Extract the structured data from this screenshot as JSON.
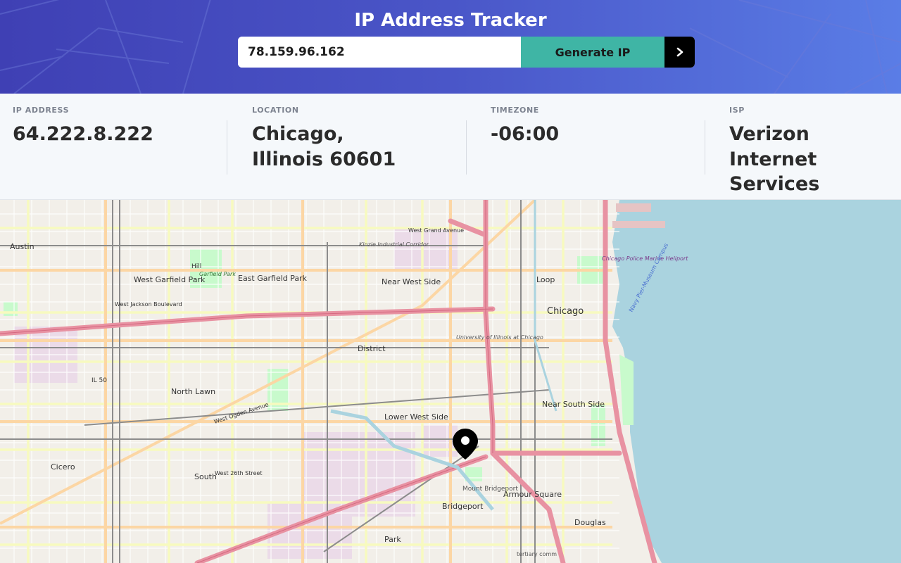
{
  "header": {
    "title": "IP Address Tracker",
    "search_value": "78.159.96.162",
    "generate_label": "Generate IP",
    "go_icon": "chevron-right-icon"
  },
  "info": {
    "ip": {
      "label": "IP ADDRESS",
      "value": "64.222.8.222"
    },
    "location": {
      "label": "LOCATION",
      "value": "Chicago, Illinois 60601"
    },
    "timezone": {
      "label": "TIMEZONE",
      "value": "-06:00"
    },
    "isp": {
      "label": "ISP",
      "value": "Verizon Internet Services"
    }
  },
  "map": {
    "places": {
      "austin": "Austin",
      "west_garfield_park": "West Garfield Park",
      "garfield_park": "Garfield Park",
      "hill": "Hill",
      "east_garfield_park": "East Garfield Park",
      "west_jackson_blvd": "West Jackson Boulevard",
      "kinzie_corridor": "Kinzie Industrial Corridor",
      "west_grand_ave": "West Grand Avenue",
      "near_west_side": "Near West Side",
      "loop": "Loop",
      "chicago": "Chicago",
      "police_heliport": "Chicago Police Marine Heliport",
      "navy_pier": "Navy Pier-Museum Campus",
      "district": "District",
      "uic": "University of Illinois at Chicago",
      "il50": "IL 50",
      "north_lawn": "North Lawn",
      "west_ogden": "West Ogden Avenue",
      "lower_west_side": "Lower West Side",
      "near_south_side": "Near South Side",
      "cicero": "Cicero",
      "south": "South",
      "w26th": "West 26th Street",
      "mount_bridgeport": "Mount Bridgeport",
      "armour_square": "Armour Square",
      "bridgeport": "Bridgeport",
      "douglas": "Douglas",
      "park": "Park",
      "tertiary": "tertiary comm"
    },
    "marker_icon": "location-pin-icon",
    "colors": {
      "land": "#f2efe9",
      "water": "#aad3df",
      "highway": "#e892a2",
      "primary": "#fcd6a4",
      "secondary": "#f7fabf",
      "park": "#c8facc",
      "rail": "#8c8c8c"
    }
  }
}
